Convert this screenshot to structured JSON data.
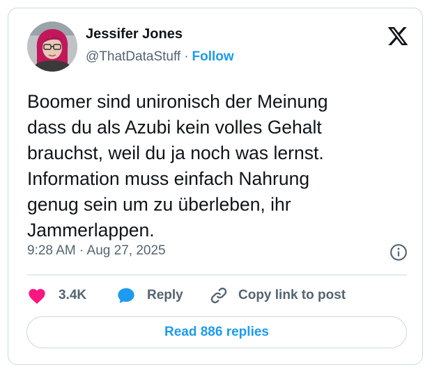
{
  "author": {
    "name": "Jessifer Jones",
    "handle": "@ThatDataStuff",
    "separator": "·",
    "follow_label": "Follow",
    "avatar_icon": "avatar-photo"
  },
  "brand_icon": "x-logo-icon",
  "tweet": {
    "text": "Boomer sind unironisch der Meinung\ndass du als Azubi kein volles Gehalt\nbrauchst, weil du ja noch was lernst.\nInformation muss einfach Nahrung\ngenug sein um zu überleben, ihr\nJammerlappen.",
    "timestamp": "9:28 AM · Aug 27, 2025"
  },
  "actions": {
    "like_count": "3.4K",
    "reply_label": "Reply",
    "copy_link_label": "Copy link to post",
    "read_replies_label": "Read 886 replies"
  },
  "colors": {
    "like": "#f91880",
    "reply": "#1d9bf0",
    "link": "#1d9bf0",
    "muted": "#536471",
    "border": "#cfd9de",
    "text": "#0f1419"
  }
}
